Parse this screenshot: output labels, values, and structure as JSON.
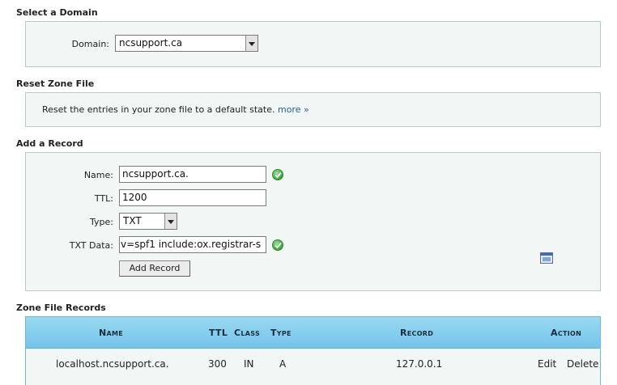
{
  "select_domain": {
    "title": "Select a Domain",
    "domain_label": "Domain:",
    "domain_value": "ncsupport.ca"
  },
  "reset_zone": {
    "title": "Reset Zone File",
    "description": "Reset the entries in your zone file to a default state.",
    "more_link": "more »"
  },
  "add_record": {
    "title": "Add a Record",
    "name_label": "Name:",
    "name_value": "ncsupport.ca.",
    "ttl_label": "TTL:",
    "ttl_value": "1200",
    "type_label": "Type:",
    "type_value": "TXT",
    "txt_label": "TXT Data:",
    "txt_value": "v=spf1 include:ox.registrar-s",
    "add_button": "Add Record"
  },
  "zone_records": {
    "title": "Zone File Records",
    "headers": {
      "name": "Name",
      "ttl": "TTL",
      "class": "Class",
      "type": "Type",
      "record": "Record",
      "action": "Action"
    },
    "rows": [
      {
        "name": "localhost.ncsupport.ca.",
        "ttl": "300",
        "class": "IN",
        "type": "A",
        "record": "127.0.0.1",
        "edit": "Edit",
        "delete": "Delete"
      }
    ]
  },
  "colors": {
    "panel_bg": "#f2f6f4",
    "panel_border": "#b9cbc3",
    "table_header": "#84cdee",
    "link": "#1c5f9c",
    "ok_green": "#3aa33a"
  }
}
